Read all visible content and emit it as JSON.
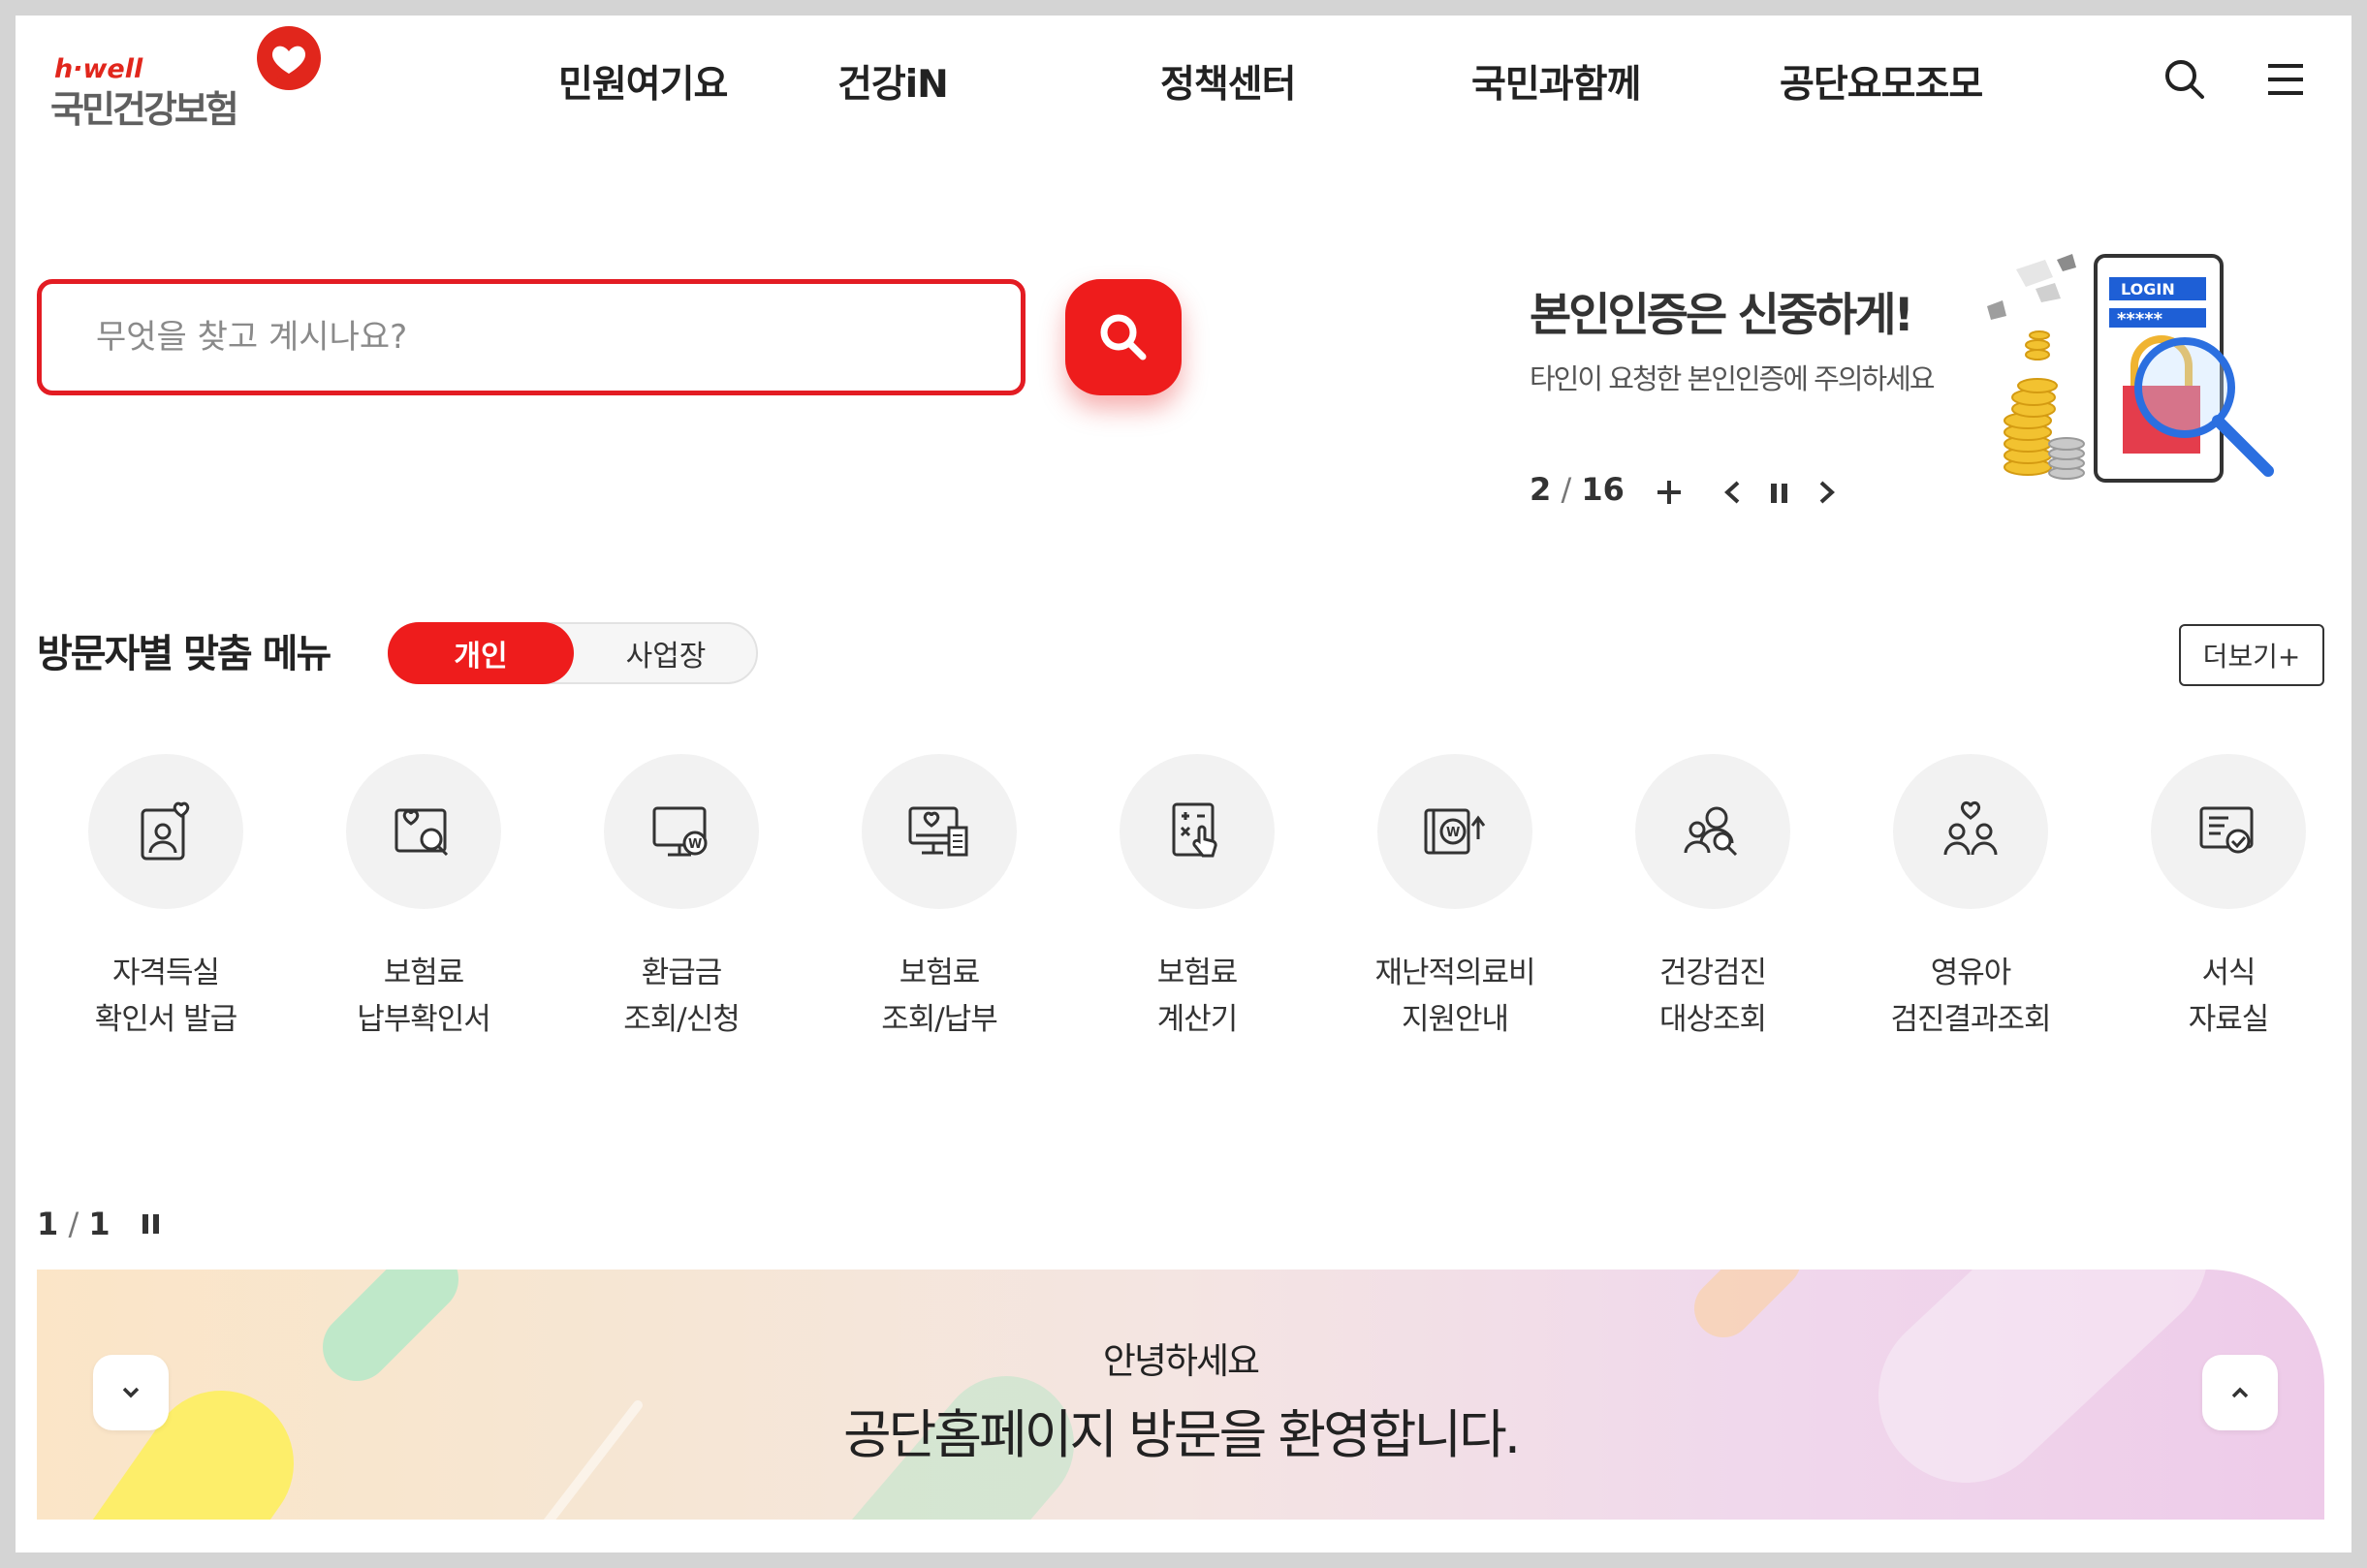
{
  "header": {
    "logo_sub": "h·well",
    "logo_main": "국민건강보험",
    "nav": [
      "민원여기요",
      "건강iN",
      "정책센터",
      "국민과함께",
      "공단요모조모"
    ]
  },
  "search": {
    "placeholder": "무엇을 찾고 계시나요?",
    "value": ""
  },
  "banner": {
    "title": "본인인증은 신중하게!",
    "subtitle": "타인이 요청한 본인인증에 주의하세요",
    "current": "2",
    "total": "16",
    "illust_text": "LOGIN",
    "illust_pw": "*****"
  },
  "menu": {
    "title": "방문자별 맞춤 메뉴",
    "tab_personal": "개인",
    "tab_business": "사업장",
    "more": "더보기+",
    "items": [
      {
        "line1": "자격득실",
        "line2": "확인서 발급",
        "icon": "person-heart-icon"
      },
      {
        "line1": "보험료",
        "line2": "납부확인서",
        "icon": "document-search-icon"
      },
      {
        "line1": "환급금",
        "line2": "조회/신청",
        "icon": "monitor-won-icon"
      },
      {
        "line1": "보험료",
        "line2": "조회/납부",
        "icon": "monitor-receipt-icon"
      },
      {
        "line1": "보험료",
        "line2": "계산기",
        "icon": "calculator-icon"
      },
      {
        "line1": "재난적의료비",
        "line2": "지원안내",
        "icon": "won-support-icon"
      },
      {
        "line1": "건강검진",
        "line2": "대상조회",
        "icon": "people-search-icon"
      },
      {
        "line1": "영유아",
        "line2": "검진결과조회",
        "icon": "family-heart-icon"
      },
      {
        "line1": "서식",
        "line2": "자료실",
        "icon": "form-check-icon"
      }
    ],
    "pager_current": "1",
    "pager_total": "1"
  },
  "welcome": {
    "hello": "안녕하세요",
    "message": "공단홈페이지 방문을 환영합니다."
  },
  "colors": {
    "accent": "#ee1c1c",
    "text": "#222222",
    "tile_bg": "#f2f2f2"
  }
}
